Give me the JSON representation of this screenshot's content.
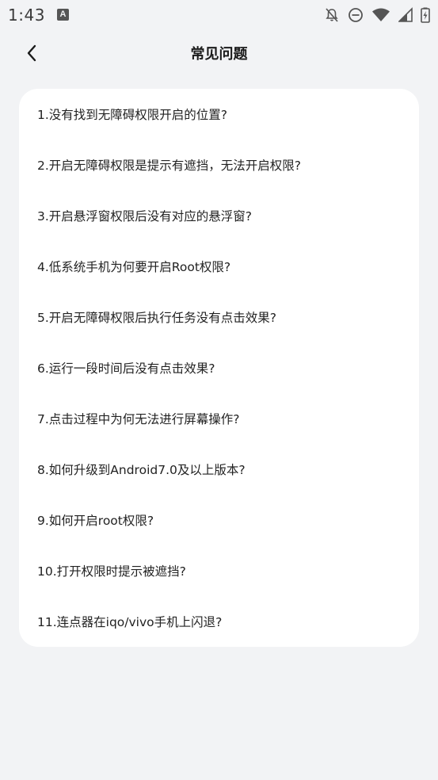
{
  "status_bar": {
    "time": "1:43",
    "app_notification_icon": "A",
    "icons": [
      "notifications-off-icon",
      "do-not-disturb-icon",
      "wifi-icon",
      "cellular-signal-icon",
      "battery-charging-icon"
    ]
  },
  "header": {
    "title": "常见问题",
    "back_icon": "chevron-left-icon"
  },
  "faq": {
    "items": [
      {
        "label": "1.没有找到无障碍权限开启的位置?"
      },
      {
        "label": "2.开启无障碍权限是提示有遮挡，无法开启权限?"
      },
      {
        "label": "3.开启悬浮窗权限后没有对应的悬浮窗?"
      },
      {
        "label": "4.低系统手机为何要开启Root权限?"
      },
      {
        "label": "5.开启无障碍权限后执行任务没有点击效果?"
      },
      {
        "label": "6.运行一段时间后没有点击效果?"
      },
      {
        "label": "7.点击过程中为何无法进行屏幕操作?"
      },
      {
        "label": "8.如何升级到Android7.0及以上版本?"
      },
      {
        "label": "9.如何开启root权限?"
      },
      {
        "label": "10.打开权限时提示被遮挡?"
      },
      {
        "label": "11.连点器在iqo/vivo手机上闪退?"
      }
    ]
  },
  "colors": {
    "background": "#f2f3f5",
    "card": "#ffffff",
    "text": "#222222"
  }
}
